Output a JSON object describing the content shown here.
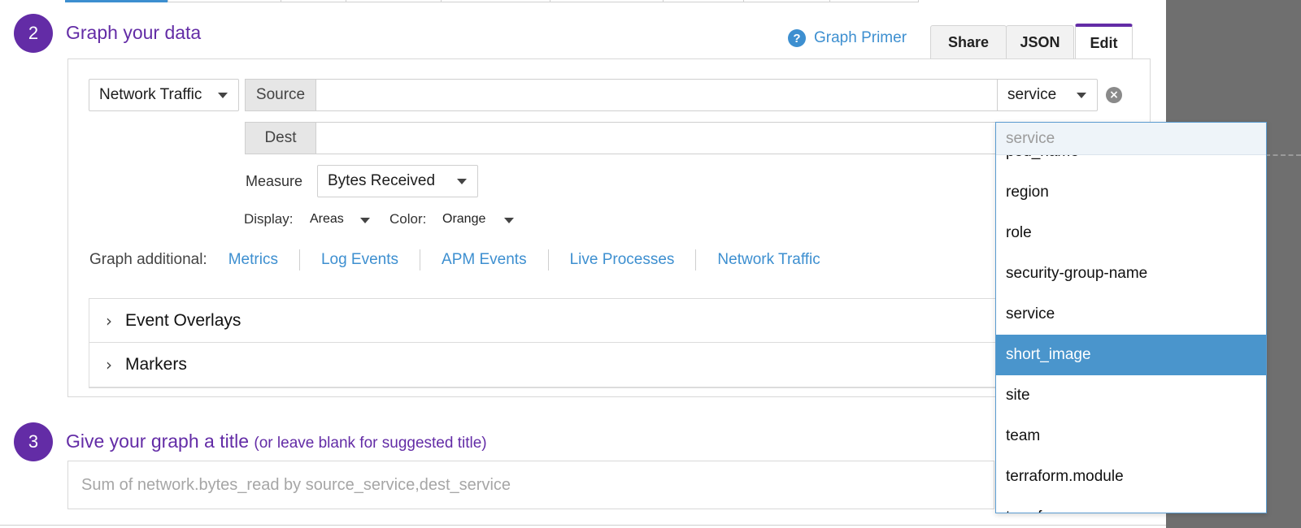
{
  "step2": {
    "number": "2",
    "title": "Graph your data",
    "graph_primer": "Graph Primer",
    "buttons": {
      "share": "Share",
      "json": "JSON",
      "edit": "Edit"
    }
  },
  "query": {
    "source_type": "Network Traffic",
    "source_label": "Source",
    "source_value": "",
    "group_by": "service",
    "dest_label": "Dest",
    "dest_value": "",
    "measure_label": "Measure",
    "measure_value": "Bytes Received",
    "display_label": "Display:",
    "display_value": "Areas",
    "color_label": "Color:",
    "color_value": "Orange"
  },
  "graph_additional": {
    "label": "Graph additional:",
    "links": [
      "Metrics",
      "Log Events",
      "APM Events",
      "Live Processes",
      "Network Traffic"
    ]
  },
  "accordions": [
    "Event Overlays",
    "Markers"
  ],
  "step3": {
    "number": "3",
    "title": "Give your graph a title",
    "hint": "(or leave blank for suggested title)",
    "placeholder": "Sum of network.bytes_read by source_service,dest_service"
  },
  "dropdown": {
    "search_placeholder": "service",
    "items": [
      "pod_name",
      "region",
      "role",
      "security-group-name",
      "service",
      "short_image",
      "site",
      "team",
      "terraform.module",
      "terraform"
    ],
    "selected": "short_image"
  },
  "colors": {
    "brand_purple": "#632ca6",
    "link_blue": "#3d8fd0",
    "selected_blue": "#4a95cc"
  }
}
